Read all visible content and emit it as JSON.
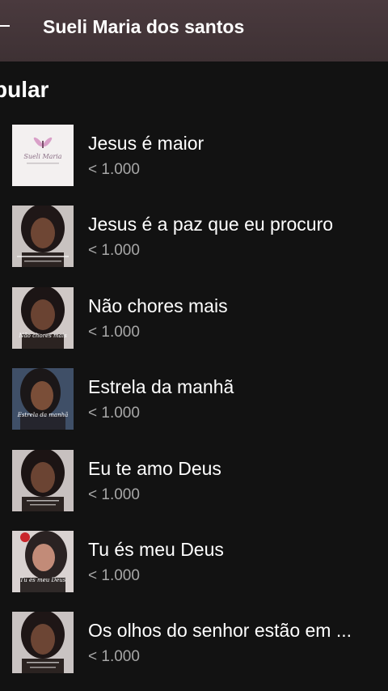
{
  "header": {
    "title": "Sueli Maria dos santos",
    "back_icon": "back-arrow-icon"
  },
  "section": {
    "title": "pular"
  },
  "tracks": [
    {
      "title": "Jesus é maior",
      "plays": "< 1.000",
      "cover_kind": "logo",
      "cover_text": "Sueli Maria"
    },
    {
      "title": "Jesus é a paz que eu procuro",
      "plays": "< 1.000",
      "cover_kind": "portrait"
    },
    {
      "title": "Não chores mais",
      "plays": "< 1.000",
      "cover_kind": "portrait",
      "cover_text": "Não chores mais"
    },
    {
      "title": "Estrela da manhã",
      "plays": "< 1.000",
      "cover_kind": "portrait-blue",
      "cover_text": "Estrela da manhã"
    },
    {
      "title": "Eu te amo Deus",
      "plays": "< 1.000",
      "cover_kind": "portrait"
    },
    {
      "title": "Tu és meu Deus",
      "plays": "< 1.000",
      "cover_kind": "portrait-light",
      "cover_text": "Tu és meu Deus"
    },
    {
      "title": "Os olhos do senhor estão em ...",
      "plays": "< 1.000",
      "cover_kind": "portrait"
    }
  ],
  "colors": {
    "background": "#121212",
    "header": "#4a3a3e",
    "secondary_text": "#a7a7a7"
  }
}
